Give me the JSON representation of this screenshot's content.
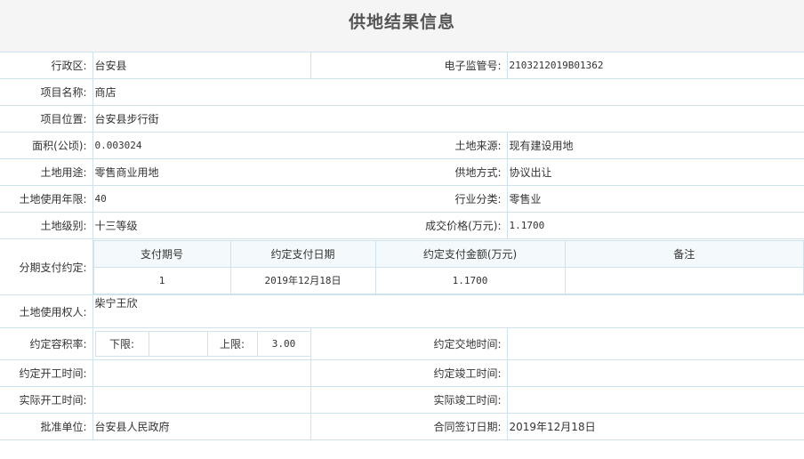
{
  "title": "供地结果信息",
  "fields": {
    "district_label": "行政区:",
    "district_value": "台安县",
    "supervision_no_label": "电子监管号:",
    "supervision_no_value": "2103212019B01362",
    "project_name_label": "项目名称:",
    "project_name_value": "商店",
    "project_location_label": "项目位置:",
    "project_location_value": "台安县步行街",
    "area_label": "面积(公顷):",
    "area_value": "0.003024",
    "land_source_label": "土地来源:",
    "land_source_value": "现有建设用地",
    "land_use_label": "土地用途:",
    "land_use_value": "零售商业用地",
    "supply_method_label": "供地方式:",
    "supply_method_value": "协议出让",
    "use_years_label": "土地使用年限:",
    "use_years_value": "40",
    "industry_label": "行业分类:",
    "industry_value": "零售业",
    "land_grade_label": "土地级别:",
    "land_grade_value": "十三等级",
    "price_label": "成交价格(万元):",
    "price_value": "1.1700",
    "installment_label": "分期支付约定:",
    "owner_label": "土地使用权人:",
    "owner_value": "柴宁王欣",
    "far_label": "约定容积率:",
    "far_lower_label": "下限:",
    "far_lower_value": "",
    "far_upper_label": "上限:",
    "far_upper_value": "3.00",
    "delivery_time_label": "约定交地时间:",
    "delivery_time_value": "",
    "start_time_label": "约定开工时间:",
    "start_time_value": "",
    "completion_time_label": "约定竣工时间:",
    "completion_time_value": "",
    "actual_start_label": "实际开工时间:",
    "actual_start_value": "",
    "actual_completion_label": "实际竣工时间:",
    "actual_completion_value": "",
    "approval_unit_label": "批准单位:",
    "approval_unit_value": "台安县人民政府",
    "contract_date_label": "合同签订日期:",
    "contract_date_value": "2019年12月18日"
  },
  "installments": {
    "headers": [
      "支付期号",
      "约定支付日期",
      "约定支付金额(万元)",
      "备注"
    ],
    "rows": [
      [
        "1",
        "2019年12月18日",
        "1.1700",
        ""
      ]
    ]
  }
}
